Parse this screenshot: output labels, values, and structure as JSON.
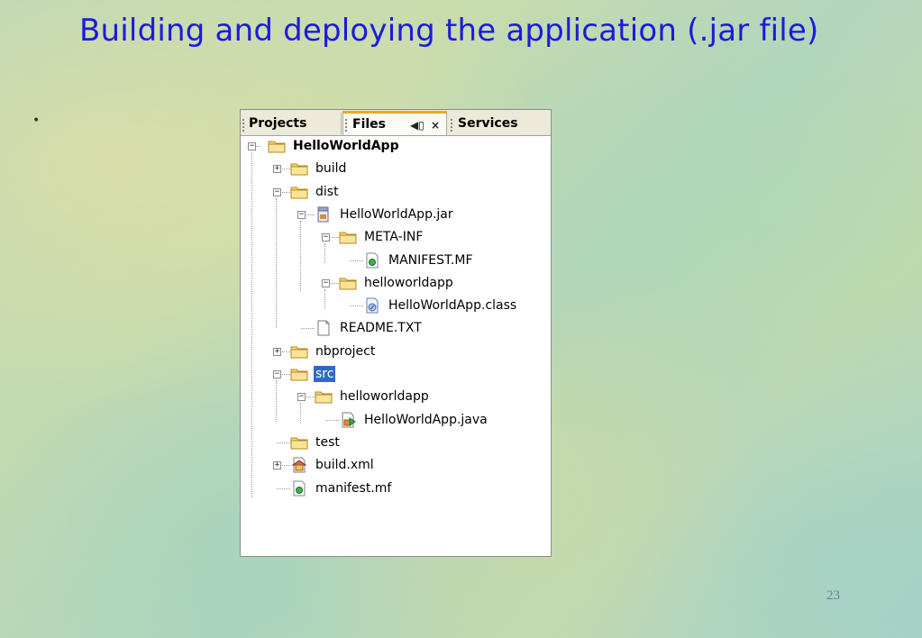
{
  "slide": {
    "title": "Building and deploying the application (.jar file)",
    "bullet": "•",
    "page_number": "23"
  },
  "tabs": [
    {
      "label": "Projects"
    },
    {
      "label": "Files",
      "controls": "◀▯ ×"
    },
    {
      "label": "Services"
    }
  ],
  "tree": [
    {
      "label": "HelloWorldApp",
      "icon": "folder-icon"
    },
    {
      "label": "build",
      "icon": "folder-icon"
    },
    {
      "label": "dist",
      "icon": "folder-icon"
    },
    {
      "label": "HelloWorldApp.jar",
      "icon": "jar-icon"
    },
    {
      "label": "META-INF",
      "icon": "folder-icon"
    },
    {
      "label": "MANIFEST.MF",
      "icon": "manifest-file-icon"
    },
    {
      "label": "helloworldapp",
      "icon": "folder-icon"
    },
    {
      "label": "HelloWorldApp.class",
      "icon": "class-file-icon"
    },
    {
      "label": "README.TXT",
      "icon": "text-file-icon"
    },
    {
      "label": "nbproject",
      "icon": "folder-icon"
    },
    {
      "label": "src",
      "icon": "folder-icon",
      "selected": true
    },
    {
      "label": "helloworldapp",
      "icon": "folder-icon"
    },
    {
      "label": "HelloWorldApp.java",
      "icon": "java-file-icon"
    },
    {
      "label": "test",
      "icon": "folder-icon"
    },
    {
      "label": "build.xml",
      "icon": "ant-build-file-icon"
    },
    {
      "label": "manifest.mf",
      "icon": "manifest-file-icon"
    }
  ],
  "colors": {
    "title": "#1b1bdc",
    "selection": "#316ac5",
    "active_tab_accent": "#f5a623"
  }
}
